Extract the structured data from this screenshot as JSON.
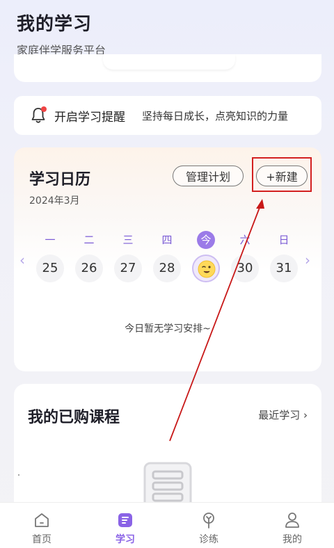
{
  "header": {
    "title": "我的学习",
    "subtitle": "家庭伴学服务平台"
  },
  "reminder": {
    "label": "开启学习提醒",
    "text": "坚持每日成长，点亮知识的力量",
    "icon": "bell-icon",
    "dot_color": "#ef4444"
  },
  "calendar": {
    "title": "学习日历",
    "month": "2024年3月",
    "manage_label": "管理计划",
    "new_label": "+新建",
    "weekdays": [
      "一",
      "二",
      "三",
      "四",
      "今",
      "六",
      "日"
    ],
    "dates": [
      "25",
      "26",
      "27",
      "28",
      "",
      "30",
      "31"
    ],
    "today_index": 4,
    "empty_text": "今日暂无学习安排~",
    "accent_color": "#9b7be8"
  },
  "courses": {
    "title": "我的已购课程",
    "recent_label": "最近学习"
  },
  "annotation": {
    "highlight_color": "#d32020"
  },
  "bottom_nav": {
    "items": [
      {
        "label": "首页",
        "icon": "home-icon",
        "active": false
      },
      {
        "label": "学习",
        "icon": "study-icon",
        "active": true
      },
      {
        "label": "诊练",
        "icon": "diagnose-icon",
        "active": false
      },
      {
        "label": "我的",
        "icon": "profile-icon",
        "active": false
      }
    ],
    "active_color": "#8a63e6"
  }
}
